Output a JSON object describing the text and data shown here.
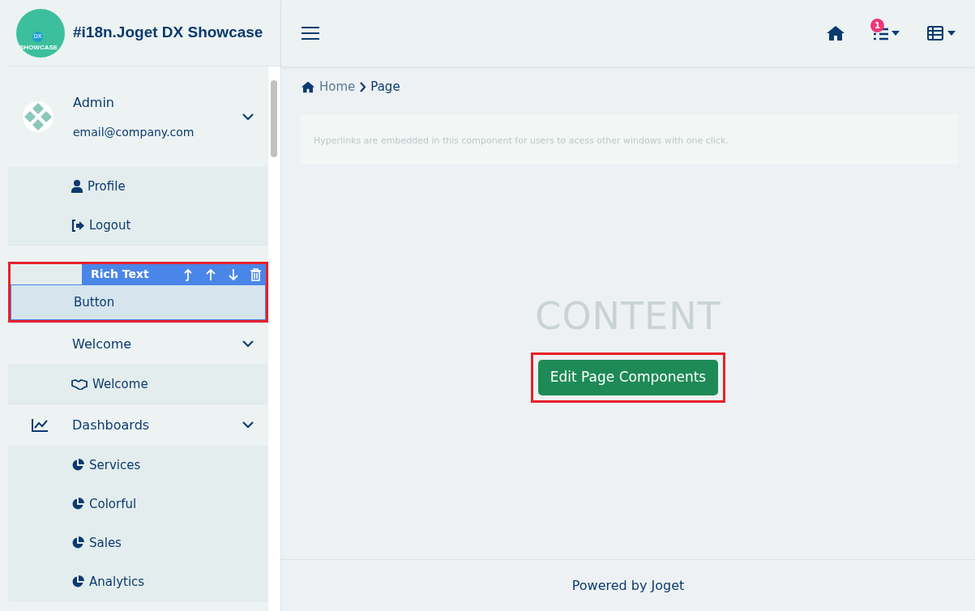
{
  "brand": {
    "title": "#i18n.Joget DX Showcase",
    "logo_badge": "DX",
    "logo_caption": "SHOWCASE"
  },
  "header": {
    "notification_count": "1"
  },
  "sidebar": {
    "user": {
      "name": "Admin",
      "email": "email@company.com",
      "expanded": true,
      "items": [
        {
          "label": "Profile"
        },
        {
          "label": "Logout"
        }
      ]
    },
    "categories": [
      {
        "expanded": true,
        "children": [
          {
            "label": "Button",
            "selected": true,
            "highlighted": true,
            "toolbar": {
              "label": "Rich Text"
            }
          }
        ]
      },
      {
        "label": "Welcome",
        "expanded": true,
        "children": [
          {
            "label": "Welcome",
            "selected": false,
            "highlighted": false
          }
        ]
      },
      {
        "label": "Dashboards",
        "expanded": true,
        "children": [
          {
            "label": "Services",
            "selected": false,
            "highlighted": false
          },
          {
            "label": "Colorful",
            "selected": false,
            "highlighted": false
          },
          {
            "label": "Sales",
            "selected": false,
            "highlighted": false
          },
          {
            "label": "Analytics",
            "selected": false,
            "highlighted": false
          }
        ]
      }
    ]
  },
  "breadcrumb": [
    {
      "label": "Home",
      "current": false
    },
    {
      "label": "Page",
      "current": true
    }
  ],
  "description": "Hyperlinks are embedded in this component for users to acess other windows with one click.",
  "placeholder_heading": "CONTENT",
  "action_button": {
    "label": "Edit Page Components",
    "highlighted": true
  },
  "footer": "Powered by Joget"
}
